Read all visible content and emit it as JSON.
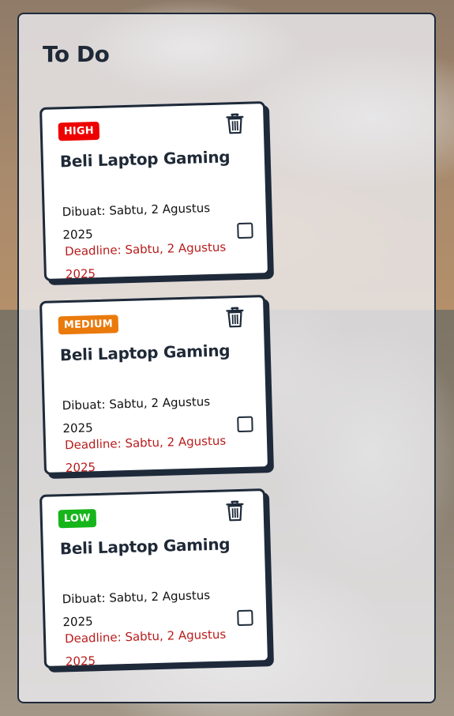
{
  "panel": {
    "title": "To Do"
  },
  "todos": [
    {
      "priority": "HIGH",
      "priority_color": "#ef0000",
      "title": "Beli Laptop Gaming",
      "created": "Dibuat: Sabtu, 2 Agustus 2025",
      "deadline": "Deadline: Sabtu, 2 Agustus 2025",
      "done": false,
      "delete_icon": "trash-icon"
    },
    {
      "priority": "MEDIUM",
      "priority_color": "#ea7a0c",
      "title": "Beli Laptop Gaming",
      "created": "Dibuat: Sabtu, 2 Agustus 2025",
      "deadline": "Deadline: Sabtu, 2 Agustus 2025",
      "done": false,
      "delete_icon": "trash-icon"
    },
    {
      "priority": "LOW",
      "priority_color": "#16b51a",
      "title": "Beli Laptop Gaming",
      "created": "Dibuat: Sabtu, 2 Agustus 2025",
      "deadline": "Deadline: Sabtu, 2 Agustus 2025",
      "done": false,
      "delete_icon": "trash-icon"
    }
  ],
  "colors": {
    "border": "#1e2a3a",
    "deadline": "#b91c1c"
  }
}
